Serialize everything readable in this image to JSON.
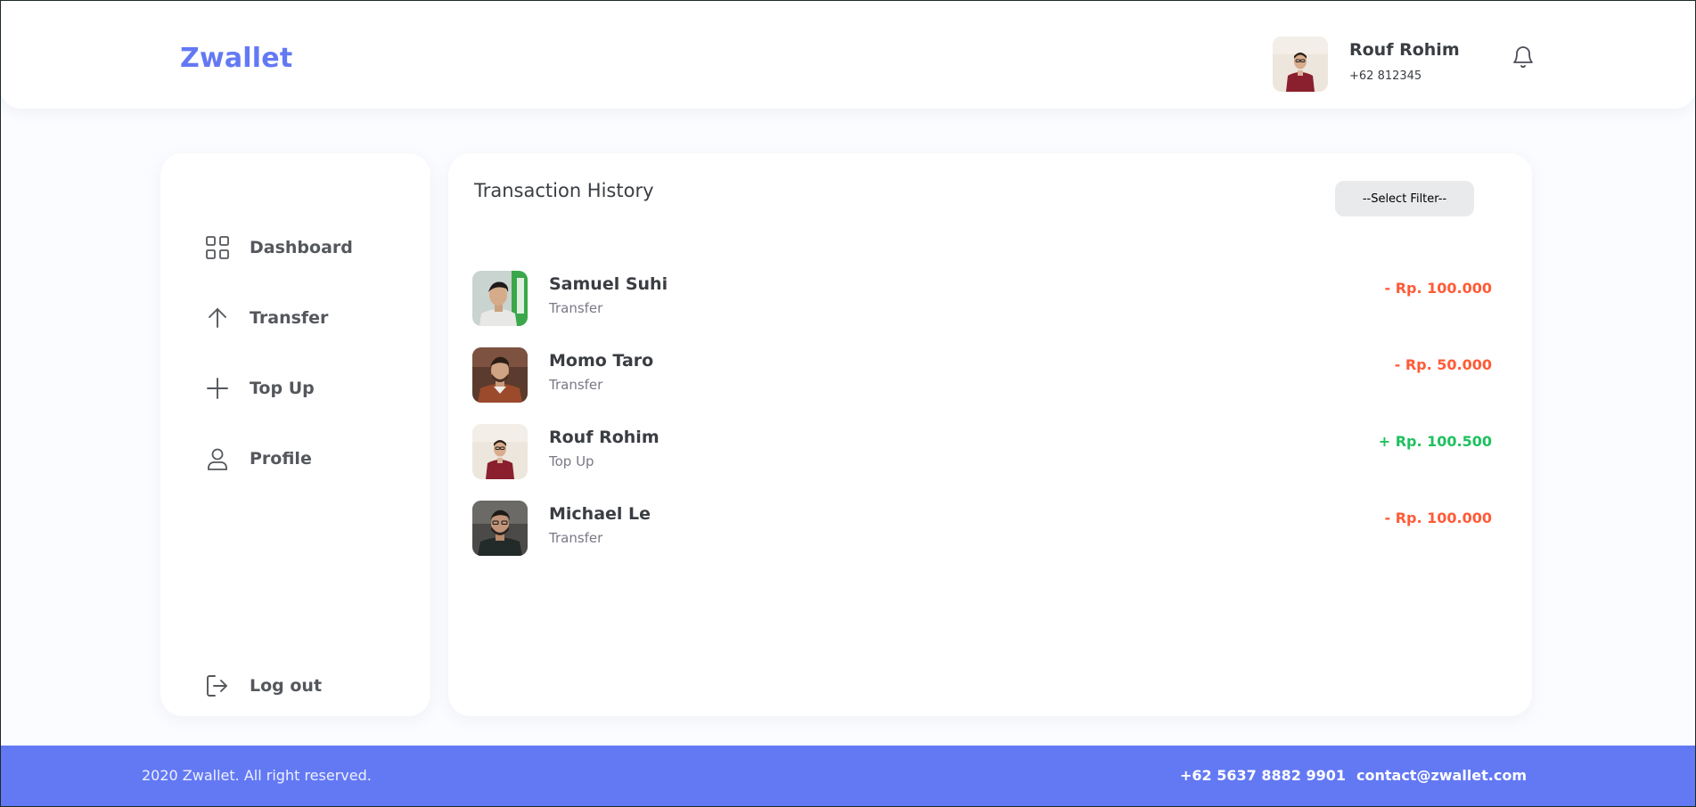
{
  "header": {
    "brand": "Zwallet",
    "user_name": "Rouf Rohim",
    "user_phone": "+62 812345",
    "notification_icon": "bell-icon"
  },
  "sidebar": {
    "items": [
      {
        "label": "Dashboard",
        "icon": "grid-icon"
      },
      {
        "label": "Transfer",
        "icon": "arrow-up-icon"
      },
      {
        "label": "Top Up",
        "icon": "plus-icon"
      },
      {
        "label": "Profile",
        "icon": "user-icon"
      }
    ],
    "logout": {
      "label": "Log out",
      "icon": "logout-icon"
    }
  },
  "main": {
    "title": "Transaction History",
    "filter_label": "--Select Filter--",
    "transactions": [
      {
        "name": "Samuel Suhi",
        "type": "Transfer",
        "amount": "- Rp. 100.000",
        "direction": "out"
      },
      {
        "name": "Momo Taro",
        "type": "Transfer",
        "amount": "- Rp. 50.000",
        "direction": "out"
      },
      {
        "name": "Rouf Rohim",
        "type": "Top Up",
        "amount": "+ Rp. 100.500",
        "direction": "in"
      },
      {
        "name": "Michael Le",
        "type": "Transfer",
        "amount": "- Rp. 100.000",
        "direction": "out"
      }
    ]
  },
  "footer": {
    "copyright": "2020 Zwallet. All right reserved.",
    "phone": "+62 5637 8882 9901",
    "email": "contact@zwallet.com"
  },
  "colors": {
    "brand": "#6379f4",
    "debit": "#ff5b37",
    "credit": "#1ec15f",
    "background": "#fafcff"
  }
}
